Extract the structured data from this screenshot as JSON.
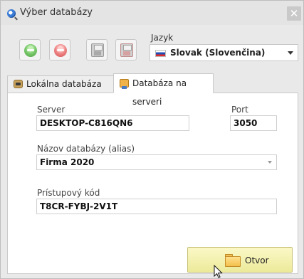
{
  "window": {
    "title": "Výber databázy",
    "close_glyph": "✕"
  },
  "toolbar": {
    "buttons": [
      {
        "icon": "add-green-icon"
      },
      {
        "icon": "remove-red-icon"
      },
      {
        "icon": "save-disk-icon"
      },
      {
        "icon": "save-disk-red-icon"
      }
    ]
  },
  "language": {
    "label": "Jazyk",
    "selected": "Slovak (Slovenčina)",
    "flag_icon": "slovak-flag-icon"
  },
  "tabs": [
    {
      "label": "Lokálna databáza",
      "icon": "local-database-icon",
      "active": false
    },
    {
      "label": "Databáza na serveri",
      "icon": "server-database-icon",
      "active": true
    }
  ],
  "server_tab": {
    "server_label": "Server",
    "server_value": "DESKTOP-C816QN6",
    "port_label": "Port",
    "port_value": "3050",
    "db_name_label": "Názov databázy (alias)",
    "db_name_value": "Firma 2020",
    "access_code_label": "Prístupový kód",
    "access_code_value": "T8CR-FYBJ-2V1T"
  },
  "actions": {
    "open_label": "Otvor",
    "open_icon": "folder-icon"
  },
  "colors": {
    "open_button": "#f3f0ae",
    "tab_active": "#ffffff",
    "window_bg": "#e9e9e9"
  }
}
